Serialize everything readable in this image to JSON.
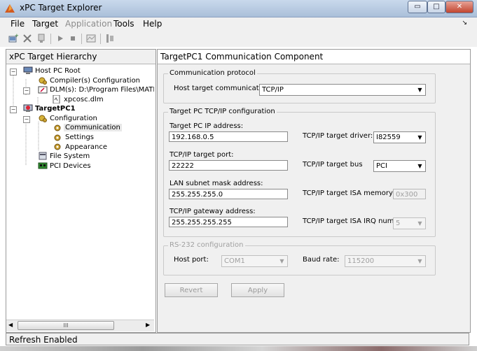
{
  "window": {
    "title": "xPC Target Explorer",
    "min": "▭",
    "max": "□",
    "close": "✕"
  },
  "menu": [
    {
      "label": "File"
    },
    {
      "label": "Target"
    },
    {
      "label": "Application"
    },
    {
      "label": "Tools"
    },
    {
      "label": "Help"
    }
  ],
  "menu_pin": "↘",
  "tree": {
    "header": "xPC Target Hierarchy",
    "nodes": [
      {
        "label": "Host PC Root"
      },
      {
        "label": "Compiler(s) Configuration"
      },
      {
        "label": "DLM(s): D:\\Program Files\\MATLAB\\"
      },
      {
        "label": "xpcosc.dlm"
      },
      {
        "label": "TargetPC1"
      },
      {
        "label": "Configuration"
      },
      {
        "label": "Communication"
      },
      {
        "label": "Settings"
      },
      {
        "label": "Appearance"
      },
      {
        "label": "File System"
      },
      {
        "label": "PCI Devices"
      }
    ],
    "scroll_grip": "III"
  },
  "content": {
    "header": "TargetPC1 Communication Component",
    "comm_group": "Communication protocol",
    "host_target_label": "Host target communication:",
    "host_target_value": "TCP/IP",
    "tcpip_group": "Target PC TCP/IP configuration",
    "ip_label": "Target PC IP address:",
    "ip_value": "192.168.0.5",
    "port_label": "TCP/IP target port:",
    "port_value": "22222",
    "mask_label": "LAN subnet mask address:",
    "mask_value": "255.255.255.0",
    "gateway_label": "TCP/IP gateway address:",
    "gateway_value": "255.255.255.255",
    "driver_label": "TCP/IP  target driver:",
    "driver_value": "I82559",
    "bus_label": "TCP/IP  target bus",
    "bus_value": "PCI",
    "isa_mem_label": "TCP/IP  target ISA memory",
    "isa_mem_value": "0x300",
    "isa_irq_label": "TCP/IP  target ISA IRQ number",
    "isa_irq_value": "5",
    "rs232_group": "RS-232 configuration",
    "host_port_label": "Host port:",
    "host_port_value": "COM1",
    "baud_label": "Baud rate:",
    "baud_value": "115200",
    "revert_label": "Revert",
    "apply_label": "Apply"
  },
  "status": "Refresh Enabled"
}
